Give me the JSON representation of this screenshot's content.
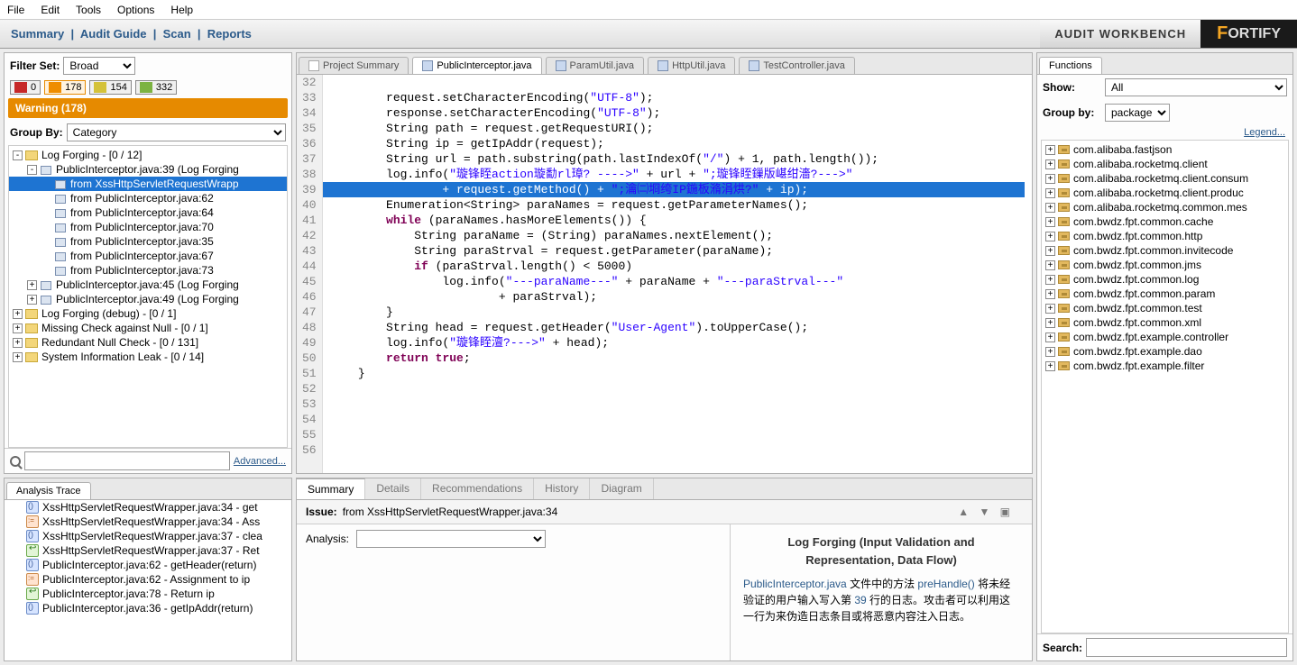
{
  "menu": {
    "file": "File",
    "edit": "Edit",
    "tools": "Tools",
    "options": "Options",
    "help": "Help"
  },
  "toolbar": {
    "summary": "Summary",
    "audit_guide": "Audit Guide",
    "scan": "Scan",
    "reports": "Reports",
    "awb": "AUDIT WORKBENCH",
    "logo_prefix": "F",
    "logo_text": "ORTIFY"
  },
  "filter": {
    "label": "Filter Set:",
    "value": "Broad"
  },
  "severity": {
    "critical": "0",
    "high": "178",
    "medium": "154",
    "low": "332"
  },
  "warning_bar": "Warning (178)",
  "groupby": {
    "label": "Group By:",
    "value": "Category"
  },
  "issues_tree": [
    {
      "indent": 0,
      "tw": "-",
      "icon": "folder",
      "label": "Log Forging - [0 / 12]"
    },
    {
      "indent": 1,
      "tw": "-",
      "icon": "java",
      "label": "PublicInterceptor.java:39 (Log Forging"
    },
    {
      "indent": 2,
      "tw": "",
      "icon": "java",
      "label": "from XssHttpServletRequestWrapp",
      "sel": true
    },
    {
      "indent": 2,
      "tw": "",
      "icon": "java",
      "label": "from PublicInterceptor.java:62"
    },
    {
      "indent": 2,
      "tw": "",
      "icon": "java",
      "label": "from PublicInterceptor.java:64"
    },
    {
      "indent": 2,
      "tw": "",
      "icon": "java",
      "label": "from PublicInterceptor.java:70"
    },
    {
      "indent": 2,
      "tw": "",
      "icon": "java",
      "label": "from PublicInterceptor.java:35"
    },
    {
      "indent": 2,
      "tw": "",
      "icon": "java",
      "label": "from PublicInterceptor.java:67"
    },
    {
      "indent": 2,
      "tw": "",
      "icon": "java",
      "label": "from PublicInterceptor.java:73"
    },
    {
      "indent": 1,
      "tw": "+",
      "icon": "java",
      "label": "PublicInterceptor.java:45 (Log Forging"
    },
    {
      "indent": 1,
      "tw": "+",
      "icon": "java",
      "label": "PublicInterceptor.java:49 (Log Forging"
    },
    {
      "indent": 0,
      "tw": "+",
      "icon": "folder",
      "label": "Log Forging (debug) - [0 / 1]"
    },
    {
      "indent": 0,
      "tw": "+",
      "icon": "folder",
      "label": "Missing Check against Null - [0 / 1]"
    },
    {
      "indent": 0,
      "tw": "+",
      "icon": "folder",
      "label": "Redundant Null Check - [0 / 131]"
    },
    {
      "indent": 0,
      "tw": "+",
      "icon": "folder",
      "label": "System Information Leak - [0 / 14]"
    }
  ],
  "advanced": "Advanced...",
  "editor_tabs": [
    {
      "label": "Project Summary",
      "icon": "proj"
    },
    {
      "label": "PublicInterceptor.java",
      "icon": "java",
      "active": true
    },
    {
      "label": "ParamUtil.java",
      "icon": "java"
    },
    {
      "label": "HttpUtil.java",
      "icon": "java"
    },
    {
      "label": "TestController.java",
      "icon": "java"
    }
  ],
  "code": {
    "start": 32,
    "hl": 39,
    "lines": [
      "",
      "        request.setCharacterEncoding(\"UTF-8\");",
      "        response.setCharacterEncoding(\"UTF-8\");",
      "        String path = request.getRequestURI();",
      "        String ip = getIpAddr(request);",
      "        String url = path.substring(path.lastIndexOf(\"/\") + 1, path.length());",
      "        log.info(\"璇锋眰action璇勫rl璋? ---->\" + url + \";璇锋眰鏁版嵁绀濇?--->\"",
      "                + request.getMethod() + \";瀹㈡埛绔IP鍦板潃涓烘?\" + ip);",
      "        Enumeration<String> paraNames = request.getParameterNames();",
      "        while (paraNames.hasMoreElements()) {",
      "            String paraName = (String) paraNames.nextElement();",
      "            String paraStrval = request.getParameter(paraName);",
      "            if (paraStrval.length() < 5000)",
      "                log.info(\"---paraName---\" + paraName + \"---paraStrval---\"",
      "                        + paraStrval);",
      "        }",
      "        String head = request.getHeader(\"User-Agent\").toUpperCase();",
      "        log.info(\"璇锋眰澶?--->\" + head);",
      "        return true;",
      "    }",
      "",
      "",
      "",
      "",
      ""
    ]
  },
  "functions": {
    "title": "Functions",
    "show_label": "Show:",
    "show_value": "All",
    "groupby_label": "Group by:",
    "groupby_value": "package",
    "legend": "Legend...",
    "packages": [
      "com.alibaba.fastjson",
      "com.alibaba.rocketmq.client",
      "com.alibaba.rocketmq.client.consum",
      "com.alibaba.rocketmq.client.produc",
      "com.alibaba.rocketmq.common.mes",
      "com.bwdz.fpt.common.cache",
      "com.bwdz.fpt.common.http",
      "com.bwdz.fpt.common.invitecode",
      "com.bwdz.fpt.common.jms",
      "com.bwdz.fpt.common.log",
      "com.bwdz.fpt.common.param",
      "com.bwdz.fpt.common.test",
      "com.bwdz.fpt.common.xml",
      "com.bwdz.fpt.example.controller",
      "com.bwdz.fpt.example.dao",
      "com.bwdz.fpt.example.filter"
    ],
    "search_label": "Search:"
  },
  "trace": {
    "title": "Analysis Trace",
    "items": [
      {
        "icon": "call",
        "text": "XssHttpServletRequestWrapper.java:34 - get"
      },
      {
        "icon": "assign",
        "text": "XssHttpServletRequestWrapper.java:34 - Ass"
      },
      {
        "icon": "call",
        "text": "XssHttpServletRequestWrapper.java:37 - clea",
        "alt": true
      },
      {
        "icon": "ret",
        "text": "XssHttpServletRequestWrapper.java:37 - Ret"
      },
      {
        "icon": "call",
        "text": "PublicInterceptor.java:62 - getHeader(return)"
      },
      {
        "icon": "assign",
        "text": "PublicInterceptor.java:62 - Assignment to ip"
      },
      {
        "icon": "ret",
        "text": "PublicInterceptor.java:78 - Return ip"
      },
      {
        "icon": "call",
        "text": "PublicInterceptor.java:36 - getIpAddr(return)"
      }
    ]
  },
  "details": {
    "tabs": [
      "Summary",
      "Details",
      "Recommendations",
      "History",
      "Diagram"
    ],
    "issue_label": "Issue:",
    "issue_value": "from XssHttpServletRequestWrapper.java:34",
    "analysis_label": "Analysis:",
    "desc_title": "Log Forging (Input Validation and Representation, Data Flow)",
    "desc_p1a": "PublicInterceptor.java",
    "desc_p1b": " 文件中的方法 ",
    "desc_p1c": "preHandle()",
    "desc_p1d": " 将未经验证的用户输入写入第 ",
    "desc_p1e": "39",
    "desc_p1f": " 行的日志。攻击者可以利用这一行为来伪造日志条目或将恶意内容注入日志。"
  }
}
